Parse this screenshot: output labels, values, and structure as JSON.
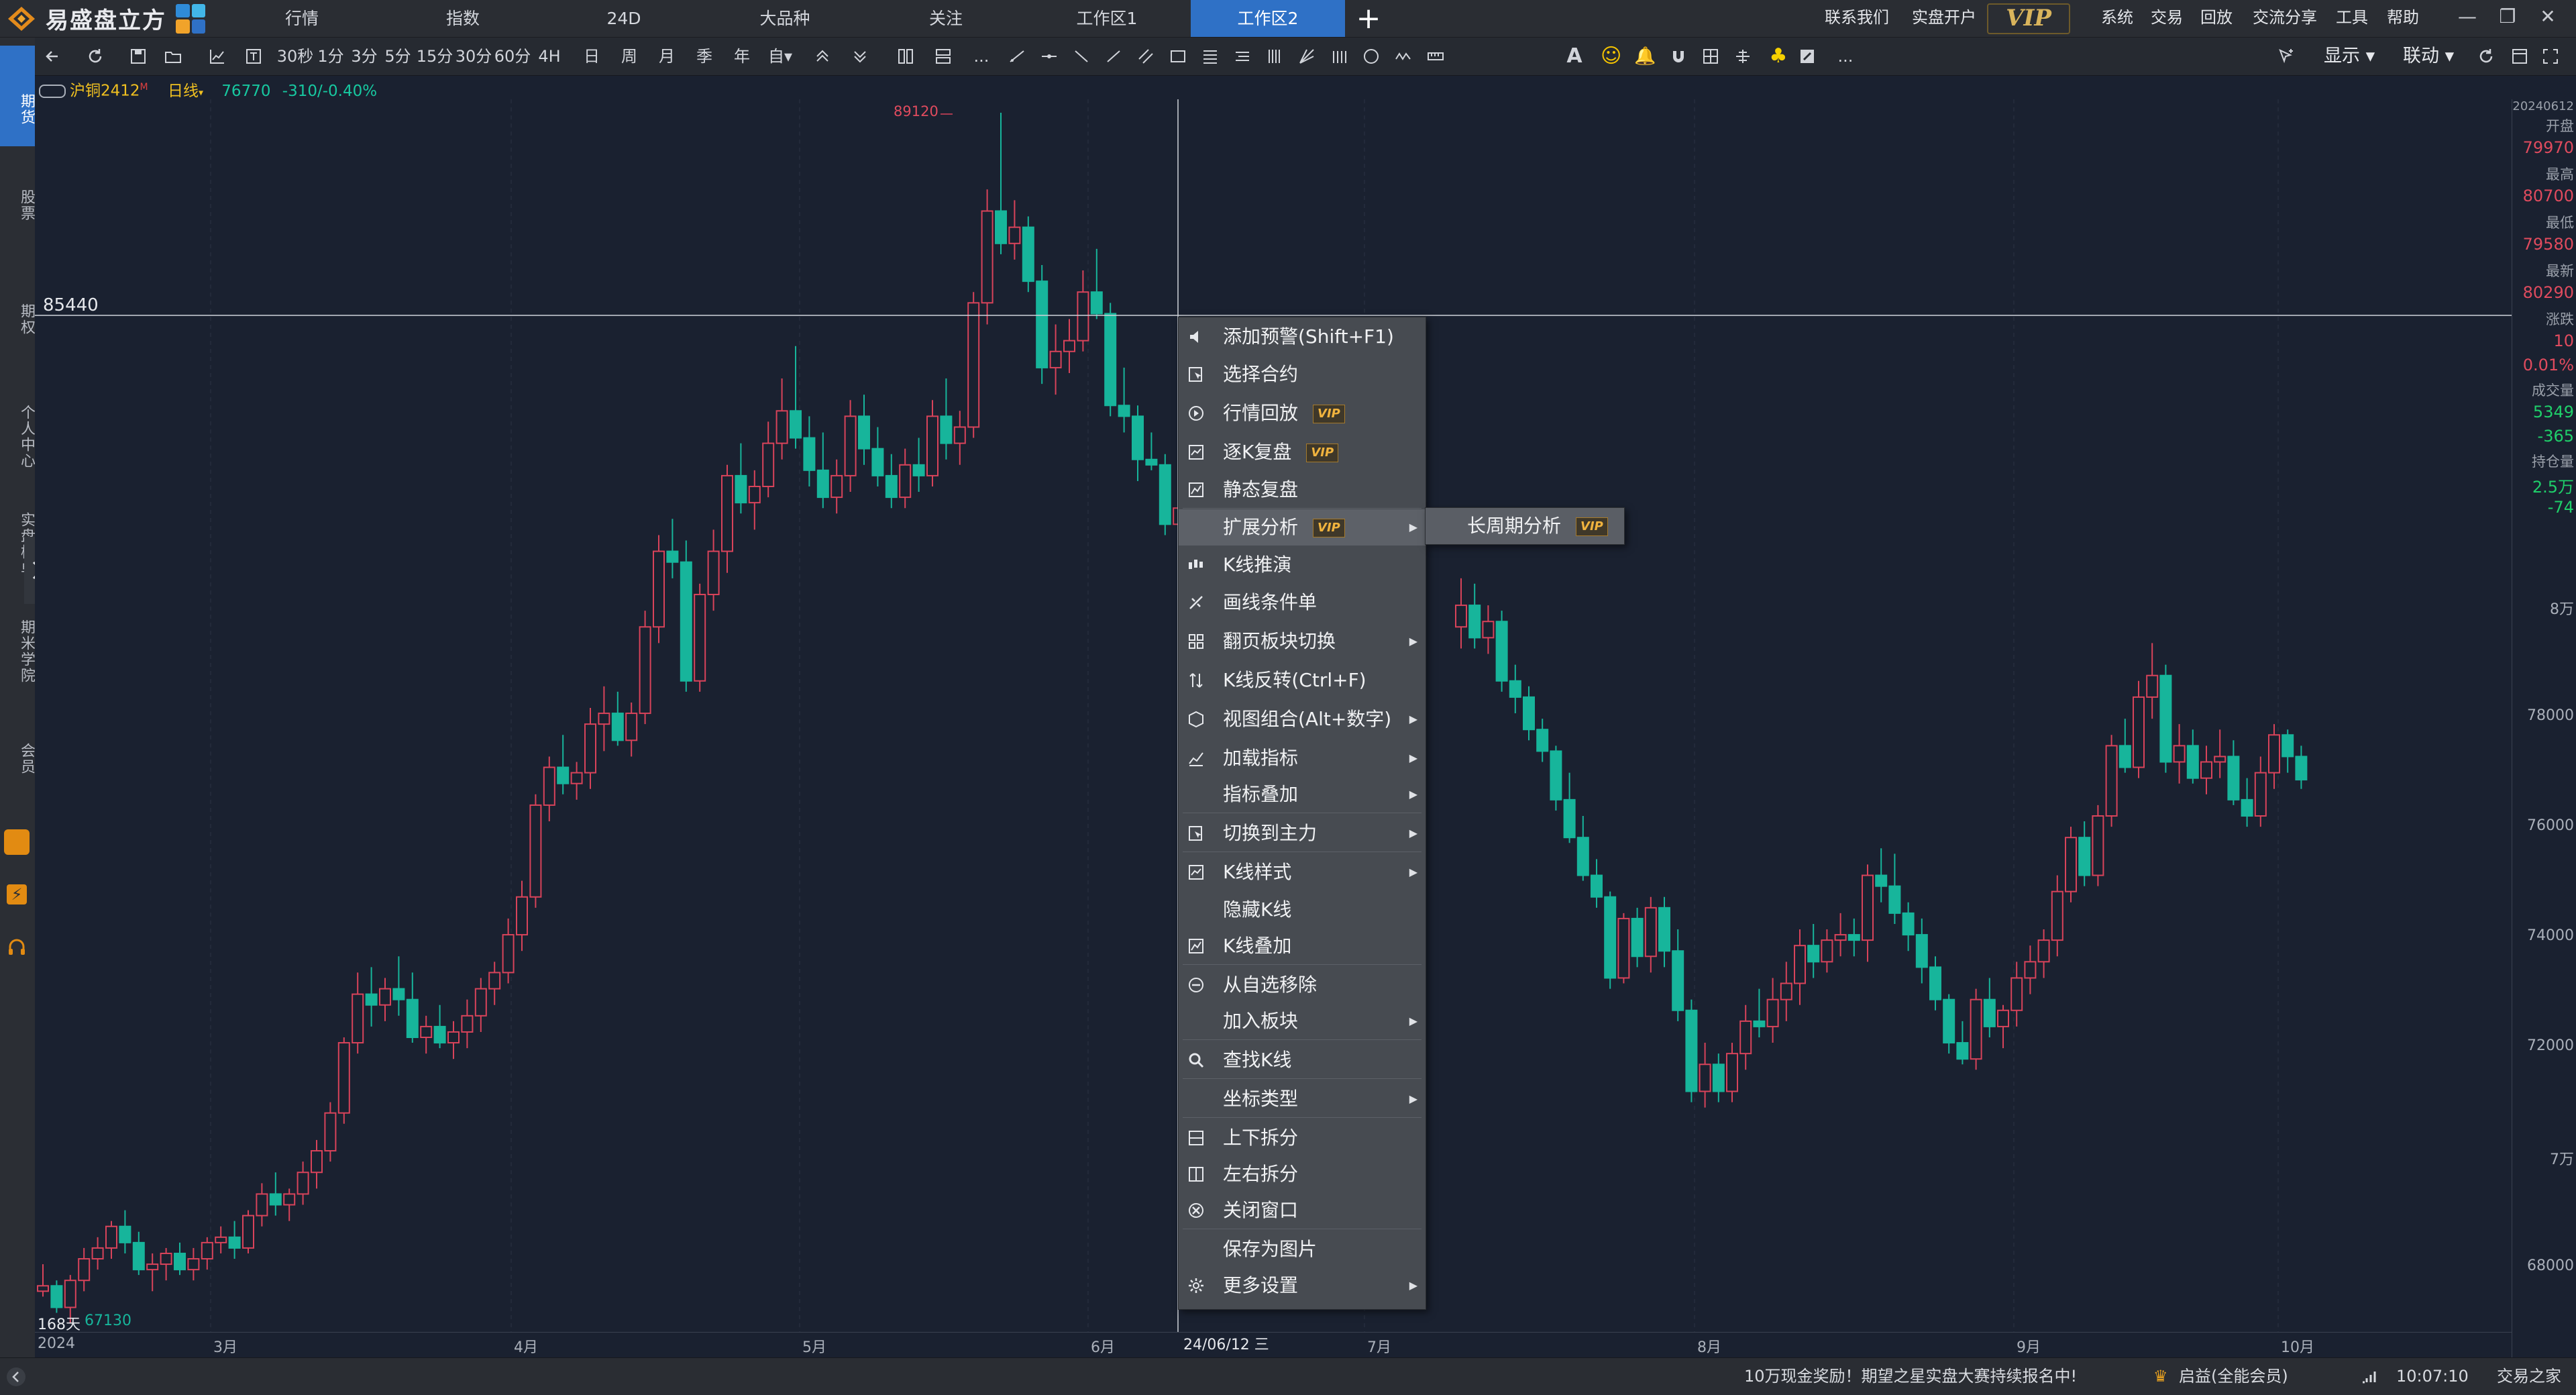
{
  "app": {
    "name": "易盛盘立方"
  },
  "nav_tabs": [
    {
      "label": "行情"
    },
    {
      "label": "指数"
    },
    {
      "label": "24D"
    },
    {
      "label": "大品种"
    },
    {
      "label": "关注"
    },
    {
      "label": "工作区1"
    },
    {
      "label": "工作区2",
      "active": true
    }
  ],
  "top_links": {
    "contact": "联系我们",
    "open_account": "实盘开户",
    "vip": "VIP",
    "system": "系统",
    "trade": "交易",
    "replay": "回放",
    "share": "交流分享",
    "tools": "工具",
    "help": "帮助"
  },
  "toolbar": {
    "periods": [
      "30秒",
      "1分",
      "3分",
      "5分",
      "15分",
      "30分",
      "60分",
      "4H",
      "日",
      "周",
      "月",
      "季",
      "年",
      "自▾"
    ],
    "more": "...",
    "display": "显示 ▾",
    "link": "联动 ▾"
  },
  "sidebar": {
    "items": [
      "期货",
      "股票",
      "期权",
      "个人中心",
      "实盘榜单",
      "期米学院",
      "会员"
    ],
    "active": "期货"
  },
  "instrument": {
    "name": "沪铜2412",
    "flag": "M",
    "period": "日线",
    "price": "76770",
    "change": "-310/-0.40%"
  },
  "crosshair": {
    "price_label": "85440",
    "date_label": "24/06/12 三"
  },
  "chart_labels": {
    "high_marker": "89120",
    "low_marker": "67130",
    "days_label": "168天"
  },
  "quote_panel": {
    "date": "20240612",
    "open_label": "开盘",
    "open": "79970",
    "high_label": "最高",
    "high": "80700",
    "low_label": "最低",
    "low": "79580",
    "last_label": "最新",
    "last": "80290",
    "change_label": "涨跌",
    "change": "10",
    "change_pct": "0.01%",
    "volume_label": "成交量",
    "volume": "5349",
    "volume_change": "-365",
    "oi_label": "持仓量",
    "oi": "2.5万",
    "oi_change": "-74"
  },
  "colors": {
    "up": "#d8435a",
    "down": "#17b59b",
    "accent": "#2f71c6",
    "vip": "#f0b33e"
  },
  "chart_data": {
    "type": "candlestick",
    "symbol": "沪铜2412",
    "period": "日线",
    "x_ticks": [
      "2024",
      "3月",
      "4月",
      "5月",
      "6月",
      "7月",
      "8月",
      "9月",
      "10月"
    ],
    "y_ticks": [
      "8万",
      "78000",
      "76000",
      "74000",
      "72000",
      "7万",
      "68000"
    ],
    "ylim": [
      66500,
      90000
    ],
    "high_marker": 89120,
    "low_marker": 67130,
    "candles": [
      [
        67300,
        67800,
        67200,
        67400
      ],
      [
        67400,
        67500,
        66900,
        67000
      ],
      [
        67000,
        67600,
        66700,
        67500
      ],
      [
        67500,
        68100,
        67300,
        67900
      ],
      [
        67900,
        68300,
        67700,
        68100
      ],
      [
        68100,
        68600,
        67900,
        68500
      ],
      [
        68500,
        68800,
        68000,
        68200
      ],
      [
        68200,
        68400,
        67600,
        67700
      ],
      [
        67700,
        68000,
        67300,
        67800
      ],
      [
        67800,
        68100,
        67500,
        68000
      ],
      [
        68000,
        68200,
        67600,
        67700
      ],
      [
        67700,
        68100,
        67500,
        67900
      ],
      [
        67900,
        68300,
        67700,
        68200
      ],
      [
        68200,
        68500,
        68000,
        68300
      ],
      [
        68300,
        68600,
        67900,
        68100
      ],
      [
        68100,
        68800,
        68000,
        68700
      ],
      [
        68700,
        69300,
        68500,
        69100
      ],
      [
        69100,
        69500,
        68700,
        68900
      ],
      [
        68900,
        69200,
        68600,
        69100
      ],
      [
        69100,
        69700,
        68900,
        69500
      ],
      [
        69500,
        70100,
        69200,
        69900
      ],
      [
        69900,
        70800,
        69700,
        70600
      ],
      [
        70600,
        72000,
        70400,
        71900
      ],
      [
        71900,
        73200,
        71700,
        72800
      ],
      [
        72800,
        73300,
        72200,
        72600
      ],
      [
        72600,
        73100,
        72300,
        72900
      ],
      [
        72900,
        73500,
        72400,
        72700
      ],
      [
        72700,
        73200,
        71900,
        72000
      ],
      [
        72000,
        72400,
        71700,
        72200
      ],
      [
        72200,
        72600,
        71800,
        71900
      ],
      [
        71900,
        72300,
        71600,
        72100
      ],
      [
        72100,
        72700,
        71800,
        72400
      ],
      [
        72400,
        73100,
        72100,
        72900
      ],
      [
        72900,
        73400,
        72600,
        73200
      ],
      [
        73200,
        74200,
        73000,
        73900
      ],
      [
        73900,
        74900,
        73600,
        74600
      ],
      [
        74600,
        76500,
        74400,
        76300
      ],
      [
        76300,
        77200,
        76000,
        77000
      ],
      [
        77000,
        77600,
        76500,
        76700
      ],
      [
        76700,
        77100,
        76400,
        76900
      ],
      [
        76900,
        78100,
        76600,
        77800
      ],
      [
        77800,
        78500,
        77300,
        78000
      ],
      [
        78000,
        78400,
        77400,
        77500
      ],
      [
        77500,
        78200,
        77200,
        78000
      ],
      [
        78000,
        79900,
        77800,
        79600
      ],
      [
        79600,
        81300,
        79300,
        81000
      ],
      [
        81000,
        81600,
        80500,
        80800
      ],
      [
        80800,
        81200,
        78400,
        78600
      ],
      [
        78600,
        80400,
        78400,
        80200
      ],
      [
        80200,
        81400,
        79900,
        81000
      ],
      [
        81000,
        82600,
        80600,
        82400
      ],
      [
        82400,
        83000,
        81700,
        81900
      ],
      [
        81900,
        82500,
        81400,
        82200
      ],
      [
        82200,
        83400,
        82000,
        83000
      ],
      [
        83000,
        84200,
        82700,
        83600
      ],
      [
        83600,
        84800,
        82900,
        83100
      ],
      [
        83100,
        83500,
        82200,
        82500
      ],
      [
        82500,
        83200,
        81800,
        82000
      ],
      [
        82000,
        82700,
        81700,
        82400
      ],
      [
        82400,
        83800,
        82100,
        83500
      ],
      [
        83500,
        83900,
        82600,
        82900
      ],
      [
        82900,
        83300,
        82200,
        82400
      ],
      [
        82400,
        82800,
        81800,
        82000
      ],
      [
        82000,
        82900,
        81800,
        82600
      ],
      [
        82600,
        83100,
        82100,
        82400
      ],
      [
        82400,
        83800,
        82200,
        83500
      ],
      [
        83500,
        84200,
        82700,
        83000
      ],
      [
        83000,
        83600,
        82600,
        83300
      ],
      [
        83300,
        85800,
        83100,
        85600
      ],
      [
        85600,
        87700,
        85200,
        87300
      ],
      [
        87300,
        89120,
        86500,
        86700
      ],
      [
        86700,
        87500,
        86400,
        87000
      ],
      [
        87000,
        87200,
        85800,
        86000
      ],
      [
        86000,
        86300,
        84100,
        84400
      ],
      [
        84400,
        85200,
        83900,
        84700
      ],
      [
        84700,
        85300,
        84300,
        84900
      ],
      [
        84900,
        86200,
        84700,
        85800
      ],
      [
        85800,
        86600,
        85300,
        85400
      ],
      [
        85400,
        85600,
        83500,
        83700
      ],
      [
        83700,
        84400,
        83200,
        83500
      ],
      [
        83500,
        83700,
        82300,
        82700
      ],
      [
        82700,
        83200,
        82500,
        82600
      ],
      [
        82600,
        82800,
        81300,
        81500
      ],
      [
        81500,
        82300,
        81000,
        81800
      ],
      [
        81800,
        82200,
        81400,
        81500
      ],
      [
        81500,
        81700,
        80500,
        80900
      ],
      [
        80900,
        81400,
        80600,
        80700
      ]
    ],
    "candles_after_menu": [
      [
        79600,
        80500,
        79200,
        80000
      ],
      [
        80000,
        80400,
        79200,
        79400
      ],
      [
        79400,
        80000,
        79100,
        79700
      ],
      [
        79700,
        79900,
        78400,
        78600
      ],
      [
        78600,
        78900,
        78000,
        78300
      ],
      [
        78300,
        78500,
        77500,
        77700
      ],
      [
        77700,
        77900,
        77100,
        77300
      ],
      [
        77300,
        77400,
        76200,
        76400
      ],
      [
        76400,
        76900,
        75600,
        75700
      ],
      [
        75700,
        76100,
        74900,
        75000
      ],
      [
        75000,
        75300,
        74400,
        74600
      ],
      [
        74600,
        74700,
        72900,
        73100
      ],
      [
        73100,
        74300,
        73000,
        74200
      ],
      [
        74200,
        74400,
        73300,
        73500
      ],
      [
        73500,
        74600,
        73200,
        74400
      ],
      [
        74400,
        74600,
        73300,
        73600
      ],
      [
        73600,
        74000,
        72300,
        72500
      ],
      [
        72500,
        72700,
        70800,
        71000
      ],
      [
        71000,
        71900,
        70700,
        71500
      ],
      [
        71500,
        71700,
        70800,
        71000
      ],
      [
        71000,
        71900,
        70800,
        71700
      ],
      [
        71700,
        72600,
        71400,
        72300
      ],
      [
        72300,
        72900,
        72000,
        72200
      ],
      [
        72200,
        73100,
        71900,
        72700
      ],
      [
        72700,
        73400,
        72300,
        73000
      ],
      [
        73000,
        74000,
        72600,
        73700
      ],
      [
        73700,
        74100,
        73100,
        73400
      ],
      [
        73400,
        74000,
        73200,
        73800
      ],
      [
        73800,
        74300,
        73500,
        73900
      ],
      [
        73900,
        74200,
        73500,
        73800
      ],
      [
        73800,
        75200,
        73400,
        75000
      ],
      [
        75000,
        75500,
        74500,
        74800
      ],
      [
        74800,
        75400,
        74100,
        74300
      ],
      [
        74300,
        74500,
        73600,
        73900
      ],
      [
        73900,
        74200,
        73000,
        73300
      ],
      [
        73300,
        73500,
        72500,
        72700
      ],
      [
        72700,
        72800,
        71700,
        71900
      ],
      [
        71900,
        72300,
        71500,
        71600
      ],
      [
        71600,
        72900,
        71400,
        72700
      ],
      [
        72700,
        73100,
        72000,
        72200
      ],
      [
        72200,
        72600,
        71800,
        72500
      ],
      [
        72500,
        73400,
        72200,
        73100
      ],
      [
        73100,
        73700,
        72800,
        73400
      ],
      [
        73400,
        74000,
        73100,
        73800
      ],
      [
        73800,
        75000,
        73500,
        74700
      ],
      [
        74700,
        75900,
        74500,
        75700
      ],
      [
        75700,
        76000,
        74800,
        75000
      ],
      [
        75000,
        76300,
        74800,
        76100
      ],
      [
        76100,
        77600,
        75900,
        77400
      ],
      [
        77400,
        77900,
        76900,
        77000
      ],
      [
        77000,
        78600,
        76800,
        78300
      ],
      [
        78300,
        79300,
        77900,
        78700
      ],
      [
        78700,
        78900,
        76900,
        77100
      ],
      [
        77100,
        77800,
        76700,
        77400
      ],
      [
        77400,
        77700,
        76700,
        76800
      ],
      [
        76800,
        77400,
        76500,
        77100
      ],
      [
        77100,
        77700,
        76800,
        77200
      ],
      [
        77200,
        77500,
        76300,
        76400
      ],
      [
        76400,
        76800,
        75900,
        76100
      ],
      [
        76100,
        77200,
        75900,
        76900
      ],
      [
        76900,
        77800,
        76600,
        77600
      ],
      [
        77600,
        77700,
        76900,
        77200
      ],
      [
        77200,
        77400,
        76600,
        76770
      ]
    ]
  },
  "context_menu": {
    "items": [
      {
        "icon": "speaker-icon",
        "label": "添加预警(Shift+F1)"
      },
      {
        "icon": "select-contract-icon",
        "label": "选择合约"
      },
      {
        "icon": "replay-icon",
        "label": "行情回放",
        "vip": "VIP"
      },
      {
        "icon": "k-replay-icon",
        "label": "逐K复盘",
        "vip": "VIP"
      },
      {
        "icon": "static-replay-icon",
        "label": "静态复盘"
      },
      {
        "icon": "",
        "label": "扩展分析",
        "vip": "VIP",
        "submenu": true,
        "selected": true
      },
      {
        "icon": "k-deduction-icon",
        "label": "K线推演"
      },
      {
        "icon": "draw-order-icon",
        "label": "画线条件单"
      },
      {
        "icon": "page-switch-icon",
        "label": "翻页板块切换",
        "submenu": true
      },
      {
        "icon": "flip-icon",
        "label": "K线反转(Ctrl+F)"
      },
      {
        "icon": "view-combo-icon",
        "label": "视图组合(Alt+数字)",
        "submenu": true
      },
      {
        "icon": "load-indicator-icon",
        "label": "加载指标",
        "submenu": true
      },
      {
        "icon": "",
        "label": "指标叠加",
        "submenu": true
      },
      {
        "icon": "switch-main-icon",
        "label": "切换到主力",
        "submenu": true
      },
      {
        "icon": "k-style-icon",
        "label": "K线样式",
        "submenu": true
      },
      {
        "icon": "",
        "label": "隐藏K线"
      },
      {
        "icon": "k-overlay-icon",
        "label": "K线叠加"
      },
      {
        "icon": "remove-icon",
        "label": "从自选移除"
      },
      {
        "icon": "",
        "label": "加入板块",
        "submenu": true
      },
      {
        "icon": "search-icon",
        "label": "查找K线"
      },
      {
        "icon": "",
        "label": "坐标类型",
        "submenu": true
      },
      {
        "icon": "split-vertical-icon",
        "label": "上下拆分"
      },
      {
        "icon": "split-horizontal-icon",
        "label": "左右拆分"
      },
      {
        "icon": "close-window-icon",
        "label": "关闭窗口"
      },
      {
        "icon": "",
        "label": "保存为图片"
      },
      {
        "icon": "gear-icon",
        "label": "更多设置",
        "submenu": true
      }
    ],
    "submenu": {
      "label": "长周期分析",
      "vip": "VIP"
    }
  },
  "status_bar": {
    "promo": "10万现金奖励！期望之星实盘大赛持续报名中!",
    "account": "启益(全能会员)",
    "time": "10:07:10",
    "home": "交易之家"
  }
}
